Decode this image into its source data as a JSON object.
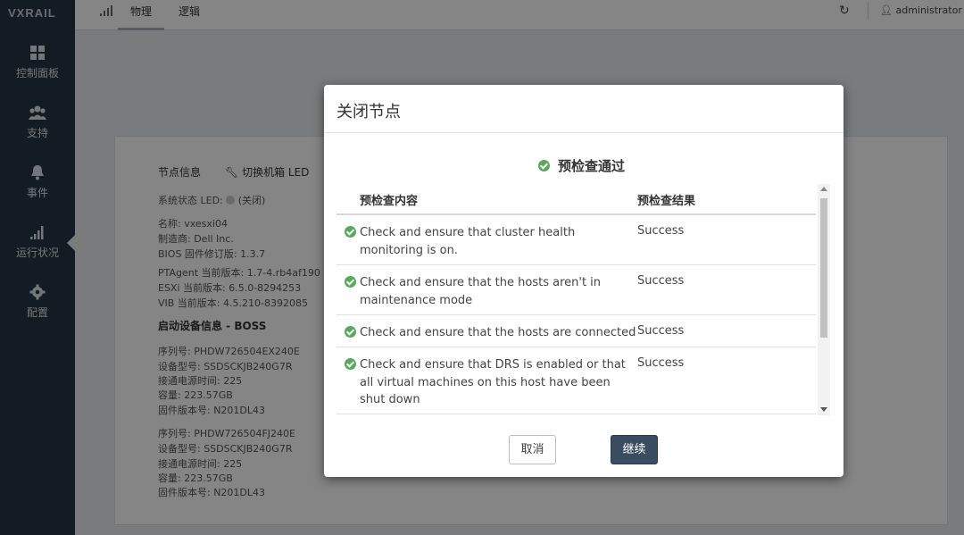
{
  "app": {
    "logo": "VXRAIL"
  },
  "sidebar": {
    "items": [
      {
        "label": "控制面板",
        "icon": "dashboard-icon"
      },
      {
        "label": "支持",
        "icon": "users-icon"
      },
      {
        "label": "事件",
        "icon": "bell-icon"
      },
      {
        "label": "运行状况",
        "icon": "signal-icon",
        "active": true
      },
      {
        "label": "配置",
        "icon": "gear-icon"
      }
    ]
  },
  "topbar": {
    "tabs": [
      {
        "label": "物理",
        "active": true
      },
      {
        "label": "逻辑"
      }
    ],
    "user": "administrator"
  },
  "background": {
    "node_info_label": "节点信息",
    "toggle_led": "切换机箱 LED",
    "system_led": "系统状态 LED:",
    "system_led_value": "(关闭)",
    "name": "名称:    vxesxi04",
    "manufacturer": "制造商:    Dell Inc.",
    "bios": "BIOS 固件修订版:    1.3.7",
    "ptagent": "PTAgent 当前版本:    1.7-4.rb4af190",
    "esxi": "ESXi 当前版本:    6.5.0-8294253",
    "vib": "VIB 当前版本:    4.5.210-8392085",
    "boot_heading": "启动设备信息 - BOSS",
    "d1_serial": "序列号:    PHDW726504EX240E",
    "d1_model": "设备型号:    SSDSCKJB240G7R",
    "d1_power": "接通电源时间:    225",
    "d1_capacity": "容量:    223.57GB",
    "d1_firmware": "固件版本号:    N201DL43",
    "d2_serial": "序列号:    PHDW726504FJ240E",
    "d2_model": "设备型号:    SSDSCKJB240G7R",
    "d2_power": "接通电源时间:    225",
    "d2_capacity": "容量:    223.57GB",
    "d2_firmware": "固件版本号:    N201DL43"
  },
  "modal": {
    "title": "关闭节点",
    "status": "预检查通过",
    "col_content": "预检查内容",
    "col_result": "预检查结果",
    "rows": [
      {
        "desc": "Check and ensure that cluster health monitoring is on.",
        "result": "Success"
      },
      {
        "desc": "Check and ensure that the hosts aren't in maintenance mode",
        "result": "Success"
      },
      {
        "desc": "Check and ensure that the hosts are connected",
        "result": "Success"
      },
      {
        "desc": "Check and ensure that DRS is enabled or that all virtual machines on this host have been shut down",
        "result": "Success"
      }
    ],
    "cancel_label": "取消",
    "continue_label": "继续",
    "success_color": "#59a95c"
  }
}
